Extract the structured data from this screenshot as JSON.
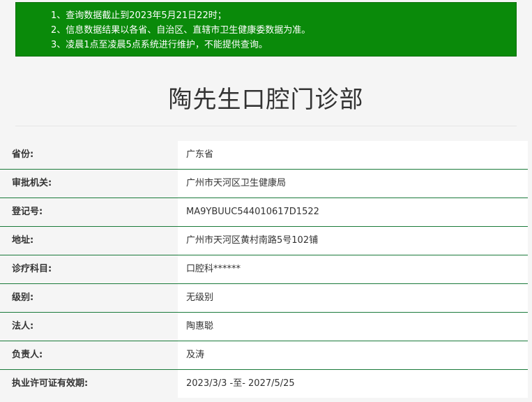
{
  "notice": {
    "lines": [
      "1、查询数据截止到2023年5月21日22时；",
      "2、信息数据结果以各省、自治区、直辖市卫生健康委数据为准。",
      "3、凌晨1点至凌晨5点系统进行维护，不能提供查询。"
    ]
  },
  "page": {
    "title": "陶先生口腔门诊部"
  },
  "details": {
    "rows": [
      {
        "label": "省份:",
        "value": "广东省"
      },
      {
        "label": "审批机关:",
        "value": "广州市天河区卫生健康局"
      },
      {
        "label": "登记号:",
        "value": "MA9YBUUC544010617D1522"
      },
      {
        "label": "地址:",
        "value": "广州市天河区黄村南路5号102铺"
      },
      {
        "label": "诊疗科目:",
        "value": "口腔科******"
      },
      {
        "label": "级别:",
        "value": "无级别"
      },
      {
        "label": "法人:",
        "value": "陶惠聪"
      },
      {
        "label": "负责人:",
        "value": "及涛"
      },
      {
        "label": "执业许可证有效期:",
        "value": "2023/3/3 -至- 2027/5/25"
      }
    ]
  }
}
